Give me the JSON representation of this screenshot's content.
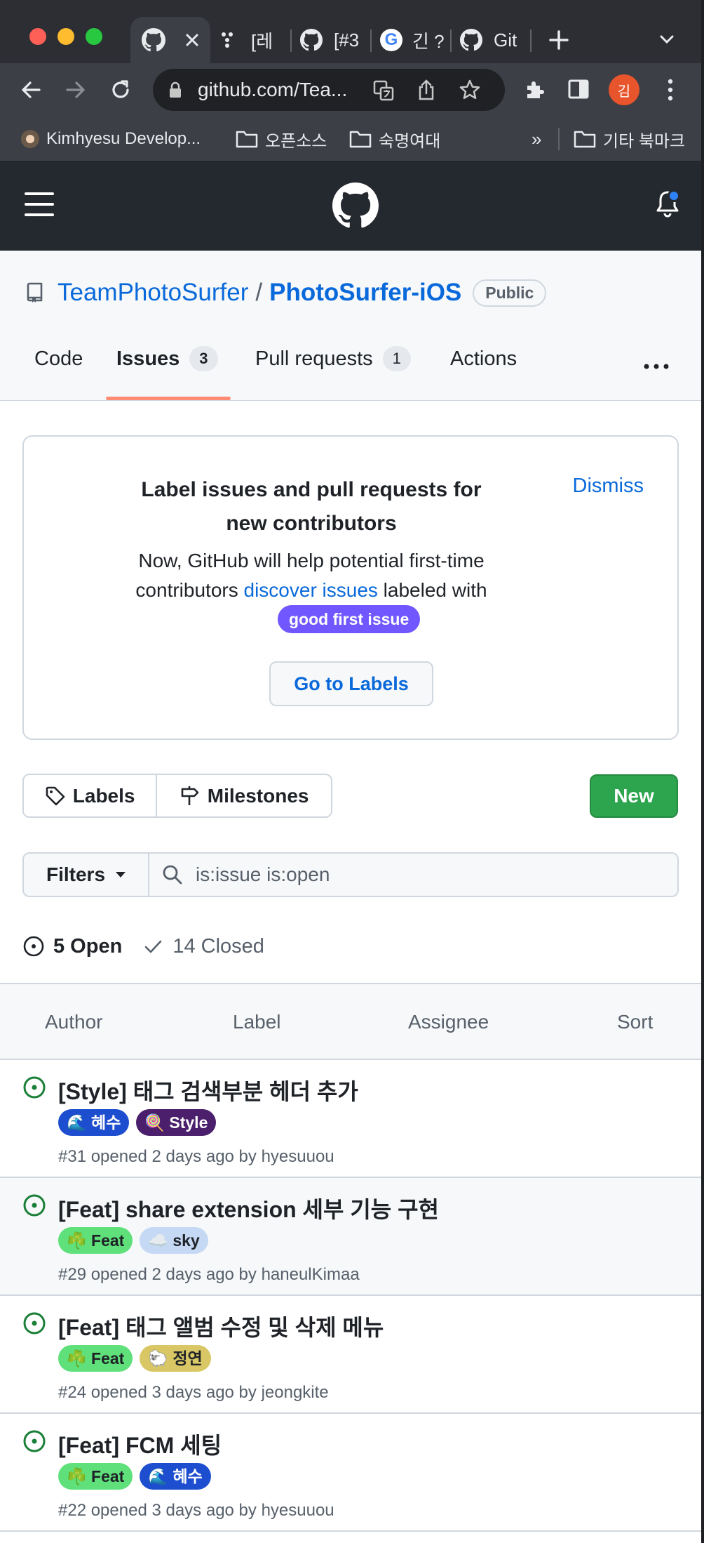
{
  "browser": {
    "tabs": [
      {
        "label": ""
      },
      {
        "label": "[레"
      },
      {
        "label": "[#3"
      },
      {
        "label": "긴 ?"
      },
      {
        "label": "Git"
      }
    ],
    "url": "github.com/Tea...",
    "profile_initial": "김",
    "bookmarks": [
      {
        "label": "Kimhyesu Develop..."
      },
      {
        "label": "오픈소스"
      },
      {
        "label": "숙명여대"
      }
    ],
    "bookmarks_overflow": "»",
    "other_bookmarks": "기타 북마크"
  },
  "repo": {
    "owner": "TeamPhotoSurfer",
    "slash": "/",
    "name": "PhotoSurfer-iOS",
    "visibility": "Public"
  },
  "nav": {
    "code": "Code",
    "issues": "Issues",
    "issues_count": "3",
    "pulls": "Pull requests",
    "pulls_count": "1",
    "actions": "Actions"
  },
  "banner": {
    "title": "Label issues and pull requests for new contributors",
    "dismiss": "Dismiss",
    "desc_line1": "Now, GitHub will help potential first-time",
    "desc_pre": "contributors ",
    "desc_link": "discover issues",
    "desc_post": " labeled with",
    "label": "good first issue",
    "button": "Go to Labels"
  },
  "toolbar": {
    "labels": "Labels",
    "milestones": "Milestones",
    "new": "New",
    "filters": "Filters",
    "search_value": "is:issue is:open"
  },
  "states": {
    "open": "5 Open",
    "closed": "14 Closed"
  },
  "list_header": {
    "author": "Author",
    "label": "Label",
    "assignee": "Assignee",
    "sort": "Sort"
  },
  "issues": [
    {
      "title": "[Style] 태그 검색부분 헤더 추가",
      "labels": [
        {
          "text": "🌊 혜수",
          "bg": "#1d4ecf",
          "fg": "#ffffff"
        },
        {
          "text": "🍭 Style",
          "bg": "#4b1f6b",
          "fg": "#ffffff"
        }
      ],
      "meta": "#31 opened 2 days ago by hyesuuou"
    },
    {
      "title": "[Feat] share extension 세부 기능 구현",
      "labels": [
        {
          "text": "☘️ Feat",
          "bg": "#5fe07a",
          "fg": "#1f2328"
        },
        {
          "text": "☁️ sky",
          "bg": "#c5d9f4",
          "fg": "#1f2328"
        }
      ],
      "meta": "#29 opened 2 days ago by haneulKimaa"
    },
    {
      "title": "[Feat] 태그 앨범 수정 및 삭제 메뉴",
      "labels": [
        {
          "text": "☘️ Feat",
          "bg": "#5fe07a",
          "fg": "#1f2328"
        },
        {
          "text": "🐑 정연",
          "bg": "#d8c764",
          "fg": "#1f2328"
        }
      ],
      "meta": "#24 opened 3 days ago by jeongkite"
    },
    {
      "title": "[Feat] FCM 세팅",
      "labels": [
        {
          "text": "☘️ Feat",
          "bg": "#5fe07a",
          "fg": "#1f2328"
        },
        {
          "text": "🌊 혜수",
          "bg": "#1d4ecf",
          "fg": "#ffffff"
        }
      ],
      "meta": "#22 opened 3 days ago by hyesuuou"
    }
  ],
  "colors": {
    "accent_link": "#0969da",
    "new_button": "#2da44e",
    "open_icon": "#1a7f37",
    "tab_underline": "#fd8c73",
    "notification_dot": "#2f81f7"
  }
}
